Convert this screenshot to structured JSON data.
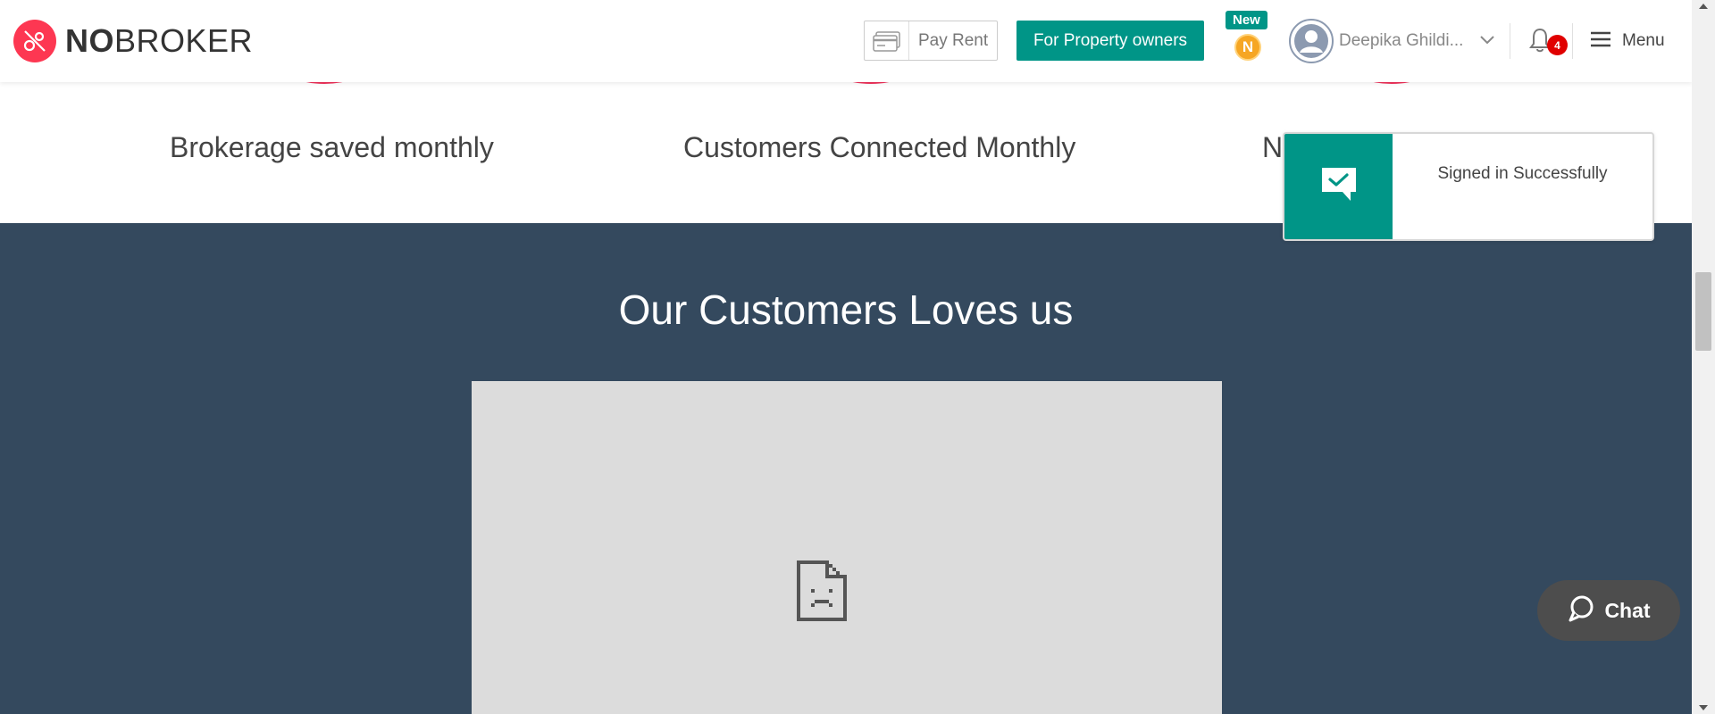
{
  "header": {
    "logo": {
      "no": "NO",
      "broker": "BROKER",
      "icon": "nobroker-logo-icon"
    },
    "pay_rent": {
      "label": "Pay Rent",
      "icon": "credit-card-icon"
    },
    "owners_button": "For Property owners",
    "new_badge": "New",
    "coin": "N",
    "user": {
      "name": "Deepika Ghildi...",
      "avatar": "user-avatar-icon"
    },
    "notifications": {
      "count": "4",
      "icon": "bell-icon"
    },
    "menu": {
      "label": "Menu",
      "icon": "hamburger-icon"
    }
  },
  "stats": [
    {
      "label": "Brokerage saved monthly"
    },
    {
      "label": "Customers Connected Monthly"
    },
    {
      "label": "N"
    }
  ],
  "section": {
    "title": "Our Customers Loves us",
    "media_icon": "broken-image-icon"
  },
  "toast": {
    "message": "Signed in Successfully",
    "icon": "message-check-icon"
  },
  "chat": {
    "label": "Chat",
    "icon": "chat-bubble-icon"
  },
  "colors": {
    "brand_red": "#fd3752",
    "teal": "#009587",
    "dark_section": "#34495e",
    "circle_border": "#f0305a"
  }
}
